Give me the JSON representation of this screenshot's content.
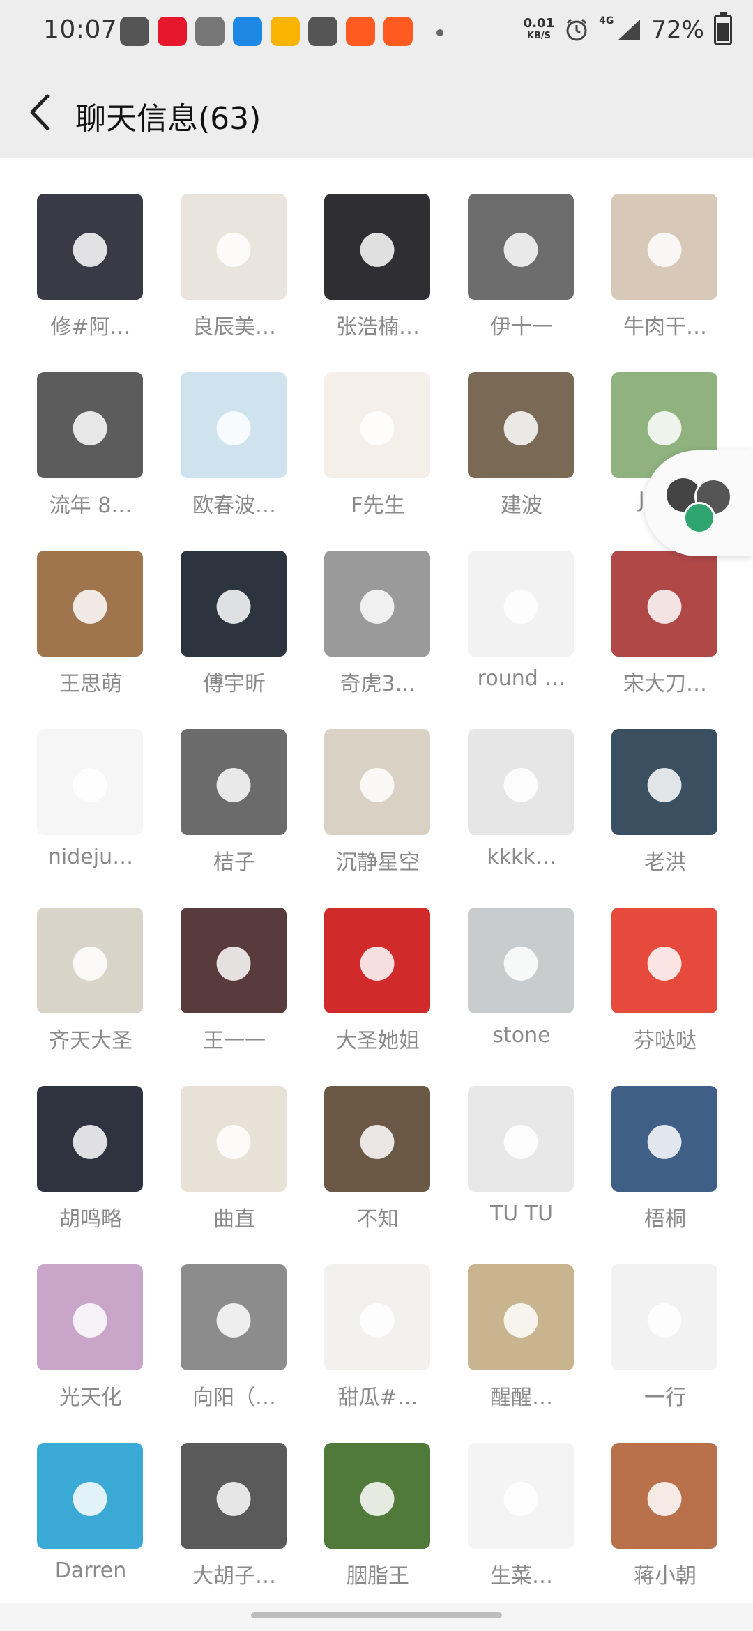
{
  "status_bar": {
    "time": "10:07",
    "net_speed_value": "0.01",
    "net_speed_unit": "KB/S",
    "network_type": "4G",
    "battery": "72%",
    "apps": [
      {
        "icon": "telegram-like-icon",
        "color": "#555555"
      },
      {
        "icon": "weibo-icon",
        "color": "#e6162d"
      },
      {
        "icon": "document-icon",
        "color": "#777777"
      },
      {
        "icon": "h-app-icon",
        "color": "#1e88e5"
      },
      {
        "icon": "pig-app-icon",
        "color": "#f8b400"
      },
      {
        "icon": "instagram-icon",
        "color": "#555555"
      },
      {
        "icon": "orange-app-icon",
        "color": "#ff5a1f"
      },
      {
        "icon": "orange-app-icon-2",
        "color": "#ff5a1f"
      }
    ]
  },
  "header": {
    "title": "聊天信息(63)"
  },
  "members": [
    {
      "name": "修#阿…",
      "color": "#3a3a46"
    },
    {
      "name": "良辰美…",
      "color": "#e9e4dc"
    },
    {
      "name": "张浩楠…",
      "color": "#2f2f33"
    },
    {
      "name": "伊十一",
      "color": "#6d6d6d"
    },
    {
      "name": "牛肉干…",
      "color": "#d8c8b8"
    },
    {
      "name": "流年 8…",
      "color": "#5c5c5c"
    },
    {
      "name": "欧春波…",
      "color": "#cfe3ef"
    },
    {
      "name": "F先生",
      "color": "#f4efe9"
    },
    {
      "name": "建波",
      "color": "#7a6a55"
    },
    {
      "name": "Jim…",
      "color": "#8fb27f"
    },
    {
      "name": "王思萌",
      "color": "#a0754d"
    },
    {
      "name": "傅宇昕",
      "color": "#2c3440"
    },
    {
      "name": "奇虎3…",
      "color": "#9a9a9a"
    },
    {
      "name": "round …",
      "color": "#f2f2f2"
    },
    {
      "name": "宋大刀…",
      "color": "#b04848"
    },
    {
      "name": "nideju…",
      "color": "#f6f6f6"
    },
    {
      "name": "桔子",
      "color": "#6b6b6b"
    },
    {
      "name": "沉静星空",
      "color": "#d9d2c4"
    },
    {
      "name": "kkkk…",
      "color": "#e6e6e6"
    },
    {
      "name": "老洪",
      "color": "#3a4f60"
    },
    {
      "name": "齐天大圣",
      "color": "#d9d4c8"
    },
    {
      "name": "王一一",
      "color": "#5a3b3b"
    },
    {
      "name": "大圣她姐",
      "color": "#d12a2a"
    },
    {
      "name": "stone",
      "color": "#c9cccc"
    },
    {
      "name": "芬哒哒",
      "color": "#e64a3c"
    },
    {
      "name": "胡鸣略",
      "color": "#2f3340"
    },
    {
      "name": "曲直",
      "color": "#e8e2d6"
    },
    {
      "name": "不知",
      "color": "#6b5946"
    },
    {
      "name": "TU TU",
      "color": "#e8e8e8"
    },
    {
      "name": "梧桐",
      "color": "#3f5f86"
    },
    {
      "name": "光天化",
      "color": "#c9a6c9"
    },
    {
      "name": "向阳（…",
      "color": "#8c8c8c"
    },
    {
      "name": "甜瓜#…",
      "color": "#f3f1ee"
    },
    {
      "name": "醒醒…",
      "color": "#c8b58f"
    },
    {
      "name": "一行",
      "color": "#f2f2f2"
    },
    {
      "name": "Darren",
      "color": "#3aa9d6"
    },
    {
      "name": "大胡子…",
      "color": "#5a5a5a"
    },
    {
      "name": "胭脂王",
      "color": "#4f7a3a"
    },
    {
      "name": "生菜…",
      "color": "#f4f4f4"
    },
    {
      "name": "蒋小朝",
      "color": "#b8714a"
    }
  ]
}
